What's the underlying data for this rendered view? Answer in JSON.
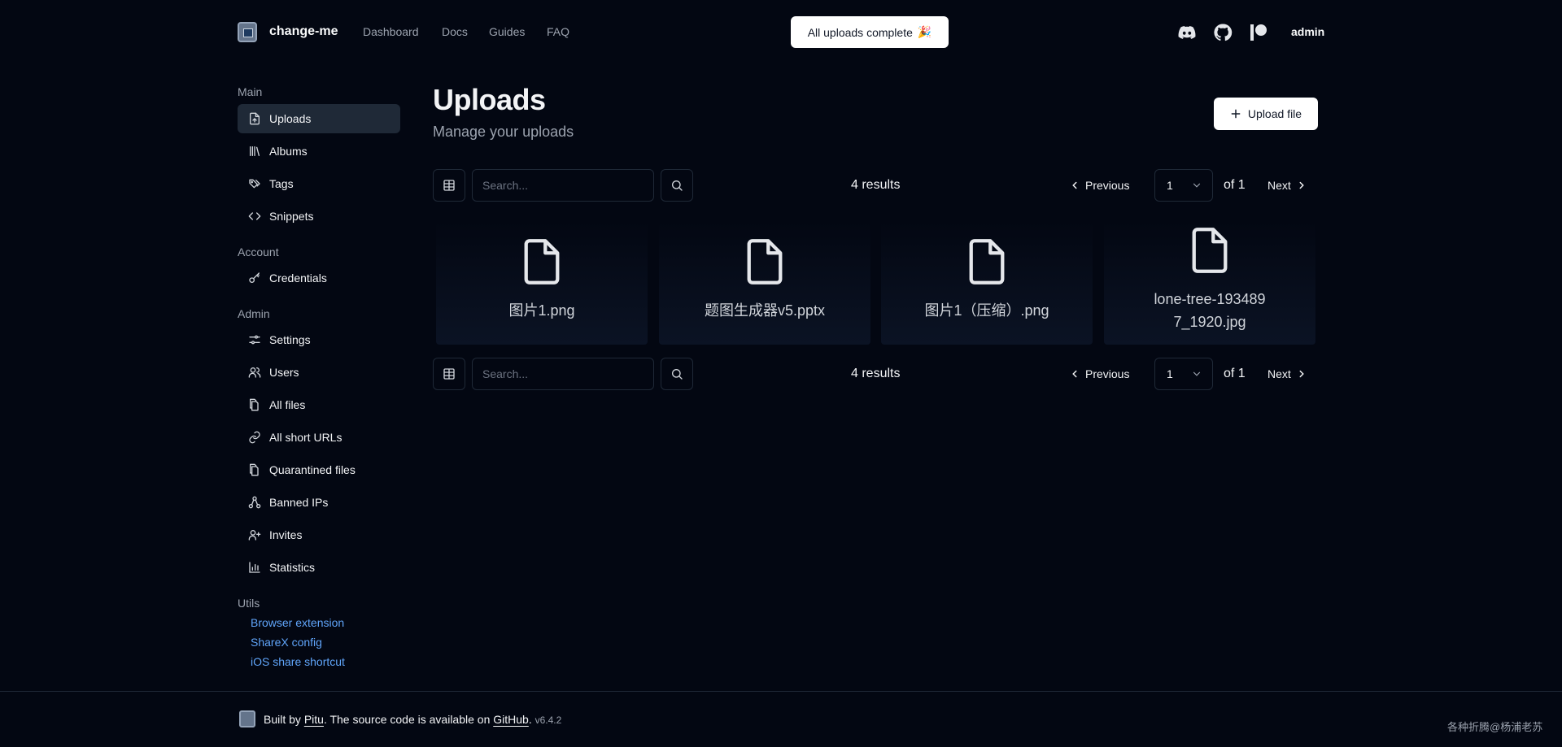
{
  "header": {
    "brand": "change-me",
    "nav": [
      "Dashboard",
      "Docs",
      "Guides",
      "FAQ"
    ],
    "toast": "All uploads complete",
    "toast_emoji": "🎉",
    "user": "admin",
    "icons": [
      "discord-icon",
      "github-icon",
      "patreon-icon"
    ]
  },
  "sidebar": {
    "sections": {
      "main": "Main",
      "account": "Account",
      "admin": "Admin",
      "utils": "Utils"
    },
    "main_items": [
      {
        "label": "Uploads",
        "icon": "upload-file-icon",
        "active": true
      },
      {
        "label": "Albums",
        "icon": "library-icon"
      },
      {
        "label": "Tags",
        "icon": "tags-icon"
      },
      {
        "label": "Snippets",
        "icon": "code-icon"
      }
    ],
    "account_items": [
      {
        "label": "Credentials",
        "icon": "key-icon"
      }
    ],
    "admin_items": [
      {
        "label": "Settings",
        "icon": "sliders-icon"
      },
      {
        "label": "Users",
        "icon": "users-icon"
      },
      {
        "label": "All files",
        "icon": "files-icon"
      },
      {
        "label": "All short URLs",
        "icon": "link-icon"
      },
      {
        "label": "Quarantined files",
        "icon": "files-icon"
      },
      {
        "label": "Banned IPs",
        "icon": "network-icon"
      },
      {
        "label": "Invites",
        "icon": "user-plus-icon"
      },
      {
        "label": "Statistics",
        "icon": "bar-chart-icon"
      }
    ],
    "utils_links": [
      "Browser extension",
      "ShareX config",
      "iOS share shortcut"
    ]
  },
  "main": {
    "title": "Uploads",
    "subtitle": "Manage your uploads",
    "upload_button": "Upload file",
    "search_placeholder": "Search...",
    "results": "4 results",
    "previous": "Previous",
    "page": "1",
    "of_pages": "of 1",
    "next": "Next",
    "files": [
      {
        "name": "图片1.png",
        "icon": "file-icon"
      },
      {
        "name": "题图生成器v5.pptx",
        "icon": "file-icon"
      },
      {
        "name": "图片1（压缩）.png",
        "icon": "file-icon"
      },
      {
        "name_line1": "lone-tree-193489",
        "name_line2": "7_1920.jpg",
        "icon": "file-icon"
      }
    ]
  },
  "footer": {
    "built_by": "Built by ",
    "author": "Pitu",
    "middle": ". The source code is available on ",
    "repo": "GitHub",
    "end": ".",
    "version": "v6.4.2",
    "watermark": "各种折腾@杨浦老苏"
  }
}
